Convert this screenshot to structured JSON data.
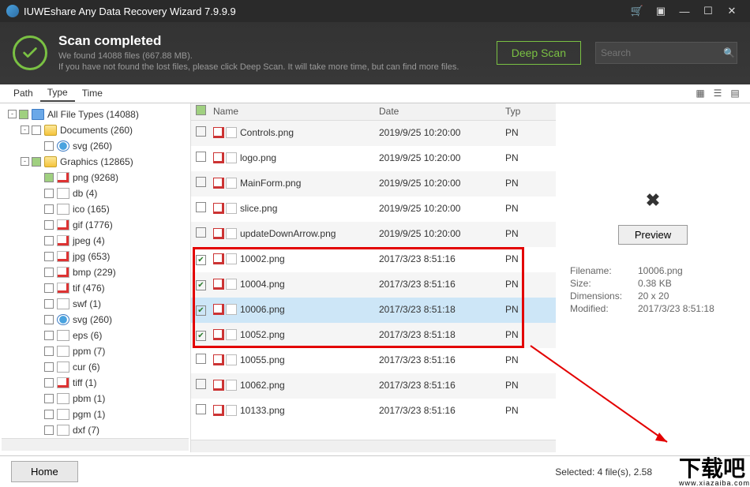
{
  "title": "IUWEshare Any Data Recovery Wizard 7.9.9.9",
  "banner": {
    "heading": "Scan completed",
    "line1": "We found 14088 files (667.88 MB).",
    "line2": "If you have not found the lost files, please click Deep Scan. It will take more time, but can find more files.",
    "deepscan": "Deep Scan",
    "search_ph": "Search"
  },
  "tabs": {
    "path": "Path",
    "type": "Type",
    "time": "Time"
  },
  "tree": {
    "root": "All File Types (14088)",
    "docs": "Documents (260)",
    "svg1": "svg (260)",
    "gfx": "Graphics (12865)",
    "items": [
      "png (9268)",
      "db (4)",
      "ico (165)",
      "gif (1776)",
      "jpeg (4)",
      "jpg (653)",
      "bmp (229)",
      "tif (476)",
      "swf (1)",
      "svg (260)",
      "eps (6)",
      "ppm (7)",
      "cur (6)",
      "tiff (1)",
      "pbm (1)",
      "pgm (1)",
      "dxf (7)"
    ]
  },
  "cols": {
    "name": "Name",
    "date": "Date",
    "type": "Typ"
  },
  "files": [
    {
      "name": "Controls.png",
      "date": "2019/9/25 10:20:00",
      "type": "PN",
      "chk": false
    },
    {
      "name": "logo.png",
      "date": "2019/9/25 10:20:00",
      "type": "PN",
      "chk": false
    },
    {
      "name": "MainForm.png",
      "date": "2019/9/25 10:20:00",
      "type": "PN",
      "chk": false
    },
    {
      "name": "slice.png",
      "date": "2019/9/25 10:20:00",
      "type": "PN",
      "chk": false
    },
    {
      "name": "updateDownArrow.png",
      "date": "2019/9/25 10:20:00",
      "type": "PN",
      "chk": false
    },
    {
      "name": "10002.png",
      "date": "2017/3/23 8:51:16",
      "type": "PN",
      "chk": true
    },
    {
      "name": "10004.png",
      "date": "2017/3/23 8:51:16",
      "type": "PN",
      "chk": true
    },
    {
      "name": "10006.png",
      "date": "2017/3/23 8:51:18",
      "type": "PN",
      "chk": true,
      "sel": true
    },
    {
      "name": "10052.png",
      "date": "2017/3/23 8:51:18",
      "type": "PN",
      "chk": true
    },
    {
      "name": "10055.png",
      "date": "2017/3/23 8:51:16",
      "type": "PN",
      "chk": false
    },
    {
      "name": "10062.png",
      "date": "2017/3/23 8:51:16",
      "type": "PN",
      "chk": false
    },
    {
      "name": "10133.png",
      "date": "2017/3/23 8:51:16",
      "type": "PN",
      "chk": false
    }
  ],
  "preview": {
    "btn": "Preview",
    "fn_l": "Filename:",
    "fn_v": "10006.png",
    "sz_l": "Size:",
    "sz_v": "0.38 KB",
    "dm_l": "Dimensions:",
    "dm_v": "20 x 20",
    "md_l": "Modified:",
    "md_v": "2017/3/23 8:51:18"
  },
  "status": {
    "home": "Home",
    "sel": "Selected: 4 file(s), 2.58"
  },
  "watermark": {
    "big": "下载吧",
    "small": "www.xiazaiba.com"
  }
}
